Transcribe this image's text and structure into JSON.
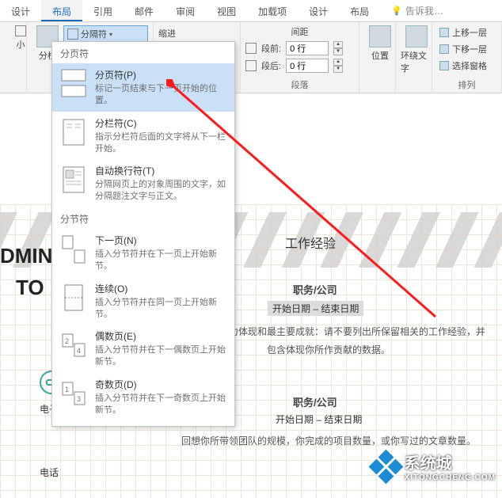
{
  "tabs": {
    "design1": "设计",
    "layout": "布局",
    "references": "引用",
    "mailings": "邮件",
    "review": "审阅",
    "view": "视图",
    "addins": "加载项",
    "design2": "设计",
    "layout2": "布局",
    "tell_me": "告诉我…"
  },
  "ribbon": {
    "size": "小",
    "columns": "分栏",
    "breaks": "分隔符",
    "indent": "缩进",
    "spacing_group": "间距",
    "before_label": "段前:",
    "after_label": "段后:",
    "before_val": "0 行",
    "after_val": "0 行",
    "paragraph_group": "段落",
    "position": "位置",
    "wrap": "环绕文字",
    "bring_forward": "上移一层",
    "send_backward": "下移一层",
    "selection_pane": "选择窗格",
    "arrange_group": "排列"
  },
  "dropdown": {
    "page_breaks_header": "分页符",
    "section_breaks_header": "分节符",
    "items": [
      {
        "title": "分页符(P)",
        "desc": "标记一页结束与下一页开始的位置。"
      },
      {
        "title": "分栏符(C)",
        "desc": "指示分栏符后面的文字将从下一栏开始。"
      },
      {
        "title": "自动换行符(T)",
        "desc": "分隔网页上的对象周围的文字，如分隔题注文字与正文。"
      },
      {
        "title": "下一页(N)",
        "desc": "插入分节符并在下一页上开始新节。"
      },
      {
        "title": "连续(O)",
        "desc": "插入分节符并在同一页上开始新节。"
      },
      {
        "title": "偶数页(E)",
        "desc": "插入分节符并在下一偶数页上开始新节。"
      },
      {
        "title": "奇数页(D)",
        "desc": "插入分节符并在下一奇数页上开始新节。"
      }
    ]
  },
  "document": {
    "heading_left1": "DMIN",
    "heading_left2": "TO",
    "section": "工作经验",
    "job_label": "职务/公司",
    "date_range": "开始日期 – 结束日期",
    "para1": "职责、领导能力体现和最主要成就：请不要列出所保留相关的工作经验，并包含体现你所作贡献的数据。",
    "para2": "回想你所带领团队的规模，你完成的项目数量，或你写过的文章数量。",
    "side_email": "电子",
    "side_phone": "电话"
  },
  "watermark": {
    "brand": "系统城",
    "sub": "XITONGCHENG.COM"
  }
}
